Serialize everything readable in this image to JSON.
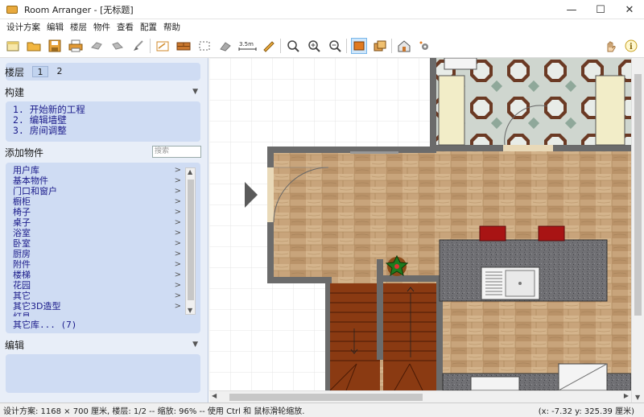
{
  "window": {
    "title": "Room Arranger - [无标题]",
    "controls": {
      "minimize": "—",
      "maximize": "☐",
      "close": "✕"
    }
  },
  "menu": [
    "设计方案",
    "编辑",
    "楼层",
    "物件",
    "查看",
    "配置",
    "帮助"
  ],
  "toolbar": {
    "icons": [
      "new-file-icon",
      "open-folder-icon",
      "save-icon",
      "print-icon",
      "undo-icon",
      "redo-icon",
      "brush-icon",
      "dimension-icon",
      "wall-icon",
      "select-area-icon",
      "copy-icon",
      "measure-icon",
      "pencil-icon",
      "zoom-fit-icon",
      "zoom-in-icon",
      "zoom-out-icon",
      "view-2d-icon",
      "view-floors-icon",
      "view-3d-icon",
      "settings-icon",
      "hand-icon",
      "info-icon"
    ],
    "measure_label": "3.5m"
  },
  "sidebar": {
    "floors": {
      "label": "楼层",
      "tabs": [
        "1",
        "2"
      ],
      "selected": "1"
    },
    "build": {
      "label": "构建",
      "steps": [
        "1.  开始新的工程",
        "2.  编辑墙壁",
        "3.  房间调整"
      ]
    },
    "add_objects": {
      "label": "添加物件",
      "search_placeholder": "搜索",
      "items": [
        "用户库",
        "基本物件",
        "门口和窗户",
        "橱柜",
        "椅子",
        "桌子",
        "浴室",
        "卧室",
        "厨房",
        "附件",
        "楼梯",
        "花园",
        "其它",
        "其它3D造型"
      ],
      "partial_item": "灯具",
      "other_libs": "其它库... (7)"
    },
    "edit": {
      "label": "编辑"
    }
  },
  "status": {
    "left": "设计方案: 1168 × 700 厘米, 楼层: 1/2 -- 缩放: 96% -- 使用 Ctrl 和 鼠标滑轮缩放.",
    "right": "(x: -7.32 y: 325.39 厘米)"
  },
  "colors": {
    "panel_bg": "#e8eef8",
    "card_bg": "#cfdcf3",
    "link_text": "#1a1a8a",
    "wall": "#6b6b6b",
    "wood_floor": "#c9a67e",
    "counter": "#6f6f72",
    "stairs": "#8a3a12",
    "chair_red": "#a81414",
    "toolbar_active": "#cde6fb"
  }
}
